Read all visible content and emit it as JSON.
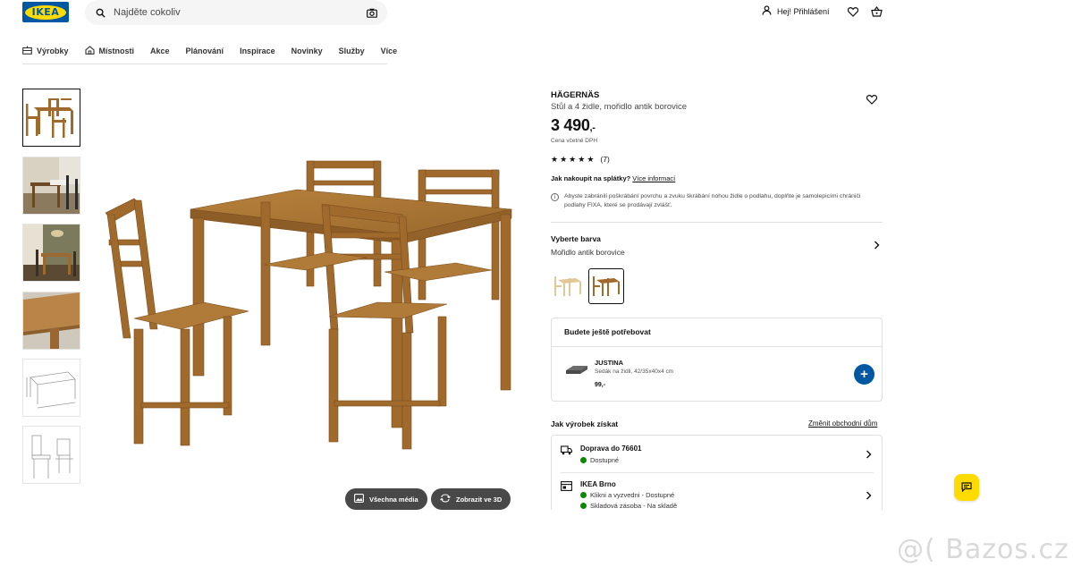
{
  "header": {
    "logo_text": "IKEA",
    "search_placeholder": "Najděte cokoliv",
    "login_label": "Hej! Přihlášení"
  },
  "nav": {
    "items": [
      "Výrobky",
      "Místnosti",
      "Akce",
      "Plánování",
      "Inspirace",
      "Novinky",
      "Služby",
      "Více"
    ]
  },
  "gallery": {
    "all_media_label": "Všechna média",
    "view_3d_label": "Zobrazit ve 3D"
  },
  "product": {
    "name": "HÄGERNÄS",
    "description": "Stůl a 4 židle, mořidlo antik borovice",
    "price": "3 490",
    "price_suffix": ",-",
    "price_note": "Cena včetně DPH",
    "rating_stars": 5,
    "review_count": "(7)",
    "installment_question": "Jak nakoupit na splátky?",
    "installment_link": "Více informací",
    "info_text": "Abyste zabránili poškrábání povrchu a zvuku škrábání nohou židle o podlahu, doplňte je samolepicími chrániči podlahy FIXA, které se prodávají zvlášť."
  },
  "color": {
    "label": "Vyberte barva",
    "value": "Mořidlo antik borovice"
  },
  "also_need": {
    "title": "Budete ještě potřebovat",
    "item_name": "JUSTINA",
    "item_desc": "Sedák na židli, 42/35x40x4 cm",
    "item_price": "99,-",
    "add_label": "+"
  },
  "get_product": {
    "title": "Jak výrobek získat",
    "change_store_link": "Změnit obchodní dům",
    "delivery_title": "Doprava do 76601",
    "delivery_status": "Dostupné",
    "store_title": "IKEA Brno",
    "store_status_1": "Klikni a vyzvedni - Dostupné",
    "store_status_2": "Skladová zásoba - Na skladě"
  },
  "watermark": "@( Bazos.cz",
  "colors": {
    "ikea_blue": "#0058a3",
    "ikea_yellow": "#ffdb00",
    "available_green": "#0a8a00",
    "wood": "#a06a2c"
  }
}
